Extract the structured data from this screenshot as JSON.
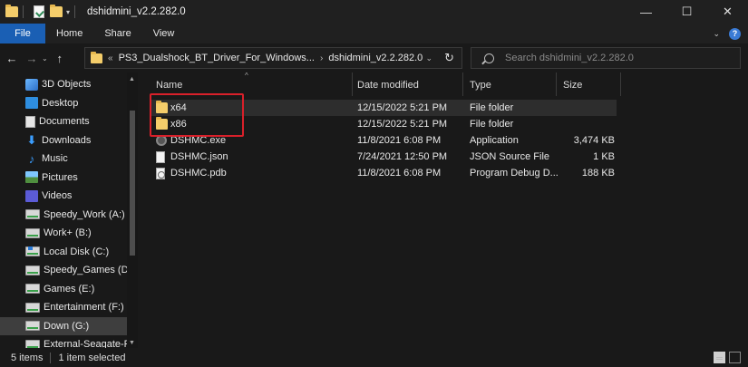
{
  "window": {
    "title": "dshidmini_v2.2.282.0",
    "minimize_glyph": "—",
    "maximize_glyph": "☐",
    "close_glyph": "✕"
  },
  "ribbon": {
    "tabs": [
      {
        "label": "File"
      },
      {
        "label": "Home"
      },
      {
        "label": "Share"
      },
      {
        "label": "View"
      }
    ],
    "expand_glyph": "⌄",
    "help_glyph": "?"
  },
  "address": {
    "back_glyph": "←",
    "forward_glyph": "→",
    "up_glyph": "↑",
    "dropdown_glyph": "⌄",
    "overflow_glyph": "«",
    "crumbs": [
      "PS3_Dualshock_BT_Driver_For_Windows...",
      "dshidmini_v2.2.282.0"
    ],
    "crumb_separator": "›",
    "refresh_glyph": "↻",
    "search_placeholder": "Search dshidmini_v2.2.282.0"
  },
  "nav_pane": {
    "items": [
      {
        "label": "3D Objects",
        "icon": "3d-objects-icon"
      },
      {
        "label": "Desktop",
        "icon": "desktop-icon"
      },
      {
        "label": "Documents",
        "icon": "documents-icon"
      },
      {
        "label": "Downloads",
        "icon": "downloads-icon"
      },
      {
        "label": "Music",
        "icon": "music-icon"
      },
      {
        "label": "Pictures",
        "icon": "pictures-icon"
      },
      {
        "label": "Videos",
        "icon": "videos-icon"
      },
      {
        "label": "Speedy_Work (A:)",
        "icon": "drive-icon"
      },
      {
        "label": "Work+ (B:)",
        "icon": "drive-icon"
      },
      {
        "label": "Local Disk (C:)",
        "icon": "system-drive-icon"
      },
      {
        "label": "Speedy_Games (D:)",
        "icon": "drive-icon"
      },
      {
        "label": "Games (E:)",
        "icon": "drive-icon"
      },
      {
        "label": "Entertainment (F:)",
        "icon": "drive-icon"
      },
      {
        "label": "Down (G:)",
        "icon": "drive-icon",
        "selected": true
      },
      {
        "label": "External-Seagate-FM",
        "icon": "drive-icon"
      }
    ],
    "scroll_up_glyph": "▲",
    "scroll_down_glyph": "▼"
  },
  "file_list": {
    "columns": [
      {
        "label": "Name"
      },
      {
        "label": "Date modified"
      },
      {
        "label": "Type"
      },
      {
        "label": "Size"
      }
    ],
    "sort_glyph": "^",
    "rows": [
      {
        "name": "x64",
        "date": "12/15/2022 5:21 PM",
        "type": "File folder",
        "size": "",
        "icon": "folder-icon",
        "selected": true
      },
      {
        "name": "x86",
        "date": "12/15/2022 5:21 PM",
        "type": "File folder",
        "size": "",
        "icon": "folder-icon"
      },
      {
        "name": "DSHMC.exe",
        "date": "11/8/2021 6:08 PM",
        "type": "Application",
        "size": "3,474 KB",
        "icon": "application-icon"
      },
      {
        "name": "DSHMC.json",
        "date": "7/24/2021 12:50 PM",
        "type": "JSON Source File",
        "size": "1 KB",
        "icon": "json-file-icon"
      },
      {
        "name": "DSHMC.pdb",
        "date": "11/8/2021 6:08 PM",
        "type": "Program Debug D...",
        "size": "188 KB",
        "icon": "pdb-file-icon"
      }
    ]
  },
  "status_bar": {
    "item_count": "5 items",
    "selection": "1 item selected"
  },
  "colors": {
    "background": "#191919",
    "file_tab": "#1a5fb4",
    "folder": "#f4cd6a",
    "highlight_box": "#d9202a",
    "selected_row": "#2d2d2d"
  }
}
